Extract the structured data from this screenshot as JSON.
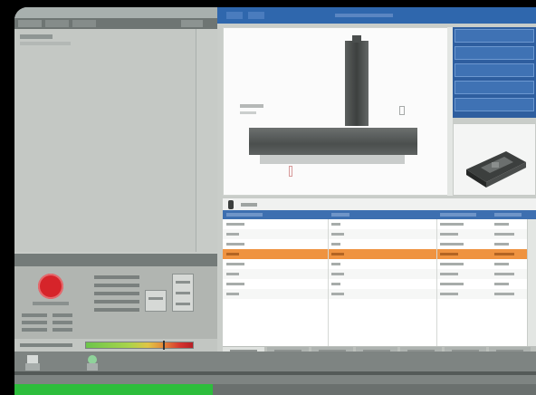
{
  "window": {
    "app_title": "",
    "right_title": "",
    "time": ""
  },
  "left_panel": {
    "menu_item": "",
    "status_header": "",
    "stop_label": "",
    "info_values": [
      "",
      "",
      "",
      ""
    ],
    "counter_rows": [
      [
        "",
        "",
        ""
      ],
      [
        "",
        "",
        ""
      ],
      [
        "",
        "",
        ""
      ],
      [
        "",
        "",
        ""
      ],
      [
        "",
        "",
        ""
      ]
    ],
    "gauge_label": "",
    "gauge_value": "",
    "gauge_level": 0.72
  },
  "right_buttons": [
    "",
    "",
    "",
    "",
    ""
  ],
  "table": {
    "search_label": "",
    "headers": [
      "",
      "",
      "",
      ""
    ],
    "rows": [
      [
        "",
        "",
        "",
        ""
      ],
      [
        "",
        "",
        "",
        ""
      ],
      [
        "",
        "",
        "",
        ""
      ],
      [
        "",
        "",
        "",
        ""
      ],
      [
        "",
        "",
        "",
        ""
      ],
      [
        "",
        "",
        "",
        ""
      ],
      [
        "",
        "",
        "",
        ""
      ],
      [
        "",
        "",
        "",
        ""
      ]
    ],
    "selected_row": 3
  },
  "bottom_tabs": [
    "",
    "",
    "",
    "",
    "",
    "",
    ""
  ],
  "progress": 0.38,
  "colors": {
    "title_bar": "#2f67ad",
    "accent_blue": "#3f72b4",
    "highlight_row": "#ef9340",
    "stop_red": "#d6242a",
    "progress_green": "#2dbd3c"
  }
}
